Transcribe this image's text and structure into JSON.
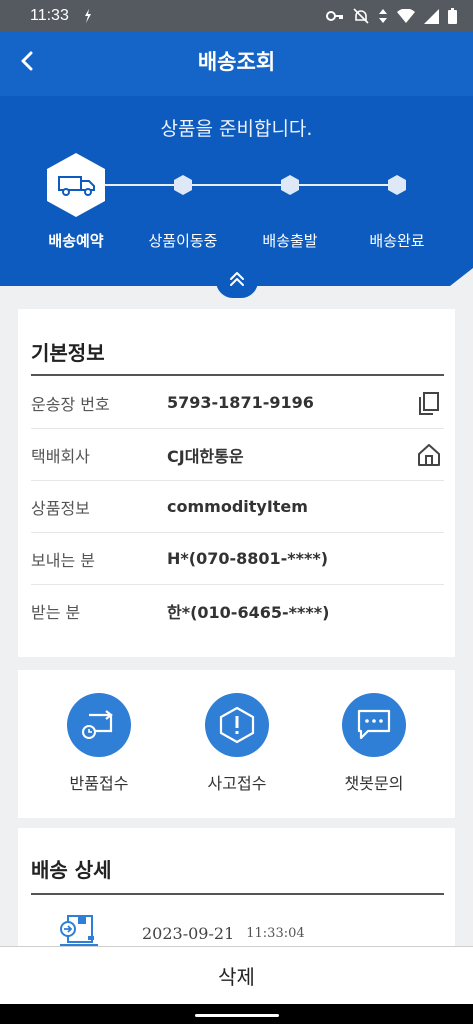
{
  "status_bar": {
    "time": "11:33",
    "icons": [
      "download-icon",
      "key-icon",
      "mute-icon",
      "data-arrows-icon",
      "wifi-icon",
      "signal-icon",
      "battery-icon"
    ]
  },
  "app_bar": {
    "title": "배송조회",
    "back_icon": "back-arrow-icon"
  },
  "progress": {
    "message": "상품을 준비합니다.",
    "current_step": 0,
    "steps": [
      {
        "label": "배송예약",
        "icon": "truck-icon"
      },
      {
        "label": "상품이동중"
      },
      {
        "label": "배송출발"
      },
      {
        "label": "배송완료"
      }
    ],
    "collapse_icon": "chevron-double-up-icon"
  },
  "basic_info": {
    "title": "기본정보",
    "rows": [
      {
        "label": "운송장 번호",
        "value": "5793-1871-9196",
        "action_icon": "copy-icon"
      },
      {
        "label": "택배회사",
        "value": "CJ대한통운",
        "action_icon": "home-icon"
      },
      {
        "label": "상품정보",
        "value": "commodityItem"
      },
      {
        "label": "보내는 분",
        "value": "H*(070-8801-****)"
      },
      {
        "label": "받는 분",
        "value": "한*(010-6465-****)"
      }
    ]
  },
  "actions": [
    {
      "label": "반품접수",
      "icon": "return-icon"
    },
    {
      "label": "사고접수",
      "icon": "alert-icon"
    },
    {
      "label": "챗봇문의",
      "icon": "chat-icon"
    }
  ],
  "delivery_detail": {
    "title": "배송 상세",
    "entries": [
      {
        "date": "2023-09-21",
        "time": "11:33:04",
        "icon": "package-register-icon"
      }
    ]
  },
  "footer": {
    "delete_label": "삭제"
  },
  "colors": {
    "primary": "#1565c8",
    "hero": "#0d5bbf",
    "action_circle": "#2f7fd6"
  }
}
